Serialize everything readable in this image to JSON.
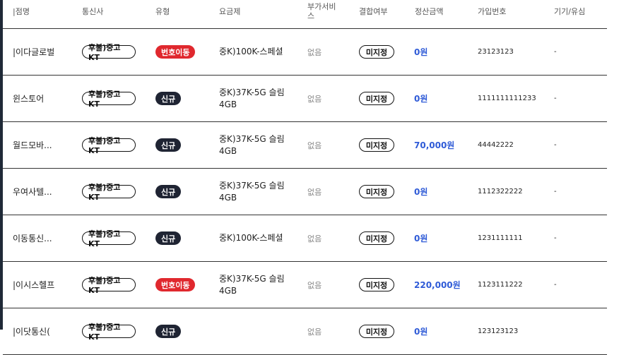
{
  "headers": {
    "store": "|점명",
    "carrier": "통신사",
    "type": "유형",
    "plan": "요금제",
    "addon_line1": "부가서비",
    "addon_line2": "스",
    "bundle": "결합여부",
    "amount": "정산금액",
    "join_no": "가입번호",
    "device": "기기/유심"
  },
  "rows": [
    {
      "store": "|이다글로벌",
      "carrier": "후불)중고KT",
      "type": "번호이동",
      "type_style": "red",
      "plan1": "중K)100K-스페셜",
      "plan2": "",
      "addon": "없음",
      "bundle": "미지정",
      "amount": "0원",
      "join_no": "23123123",
      "device": "-"
    },
    {
      "store": "윈스토어",
      "carrier": "후불)중고KT",
      "type": "신규",
      "type_style": "dark",
      "plan1": "중K)37K-5G 슬림",
      "plan2": "4GB",
      "addon": "없음",
      "bundle": "미지정",
      "amount": "0원",
      "join_no": "1111111111233",
      "device": "-"
    },
    {
      "store": "월드모바...",
      "carrier": "후불)중고KT",
      "type": "신규",
      "type_style": "dark",
      "plan1": "중K)37K-5G 슬림",
      "plan2": "4GB",
      "addon": "없음",
      "bundle": "미지정",
      "amount": "70,000원",
      "join_no": "44442222",
      "device": "-"
    },
    {
      "store": "우여사텔...",
      "carrier": "후불)중고KT",
      "type": "신규",
      "type_style": "dark",
      "plan1": "중K)37K-5G 슬림",
      "plan2": "4GB",
      "addon": "없음",
      "bundle": "미지정",
      "amount": "0원",
      "join_no": "1112322222",
      "device": "-"
    },
    {
      "store": "이동통신...",
      "carrier": "후불)중고KT",
      "type": "신규",
      "type_style": "dark",
      "plan1": "중K)100K-스페셜",
      "plan2": "",
      "addon": "없음",
      "bundle": "미지정",
      "amount": "0원",
      "join_no": "1231111111",
      "device": "-"
    },
    {
      "store": "|이시스헬프",
      "carrier": "후불)중고KT",
      "type": "번호이동",
      "type_style": "red",
      "plan1": "중K)37K-5G 슬림",
      "plan2": "4GB",
      "addon": "없음",
      "bundle": "미지정",
      "amount": "220,000원",
      "join_no": "1123111222",
      "device": "-"
    },
    {
      "store": "|이닷통신(",
      "carrier": "후불)중고KT",
      "type": "신규",
      "type_style": "dark",
      "plan1": "",
      "plan2": "",
      "addon": "없음",
      "bundle": "미지정",
      "amount": "0원",
      "join_no": "123123123",
      "device": ""
    }
  ]
}
